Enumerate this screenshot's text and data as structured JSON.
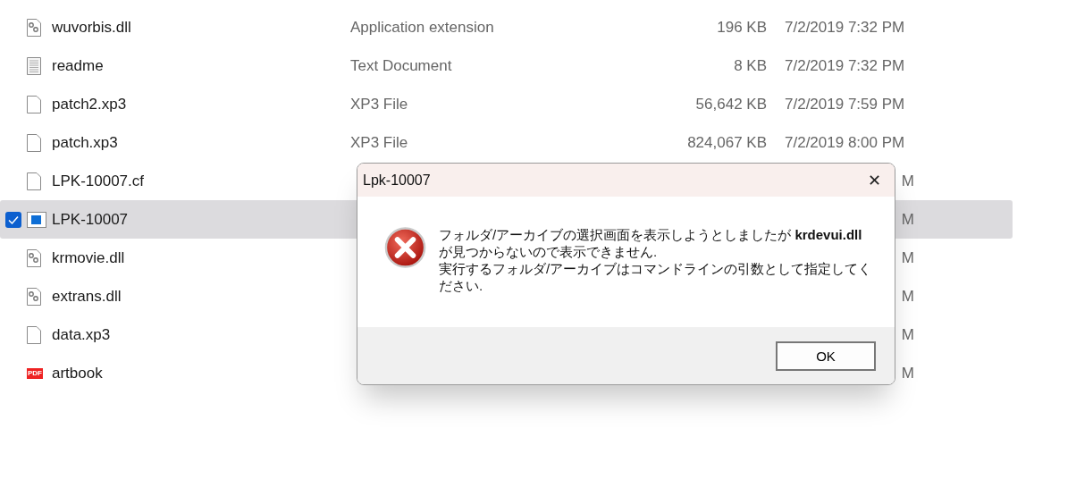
{
  "files": [
    {
      "name": "wuvorbis.dll",
      "kind": "dll",
      "type": "Application extension",
      "size": "196 KB",
      "date": "7/2/2019 7:32 PM",
      "selected": false
    },
    {
      "name": "readme",
      "kind": "text",
      "type": "Text Document",
      "size": "8 KB",
      "date": "7/2/2019 7:32 PM",
      "selected": false
    },
    {
      "name": "patch2.xp3",
      "kind": "blank",
      "type": "XP3 File",
      "size": "56,642 KB",
      "date": "7/2/2019 7:59 PM",
      "selected": false
    },
    {
      "name": "patch.xp3",
      "kind": "blank",
      "type": "XP3 File",
      "size": "824,067 KB",
      "date": "7/2/2019 8:00 PM",
      "selected": false
    },
    {
      "name": "LPK-10007.cf",
      "kind": "blank",
      "date": "M",
      "selected": false
    },
    {
      "name": "LPK-10007",
      "kind": "app",
      "date": "M",
      "selected": true
    },
    {
      "name": "krmovie.dll",
      "kind": "dll",
      "date": "M",
      "selected": false
    },
    {
      "name": "extrans.dll",
      "kind": "dll",
      "date": "M",
      "selected": false
    },
    {
      "name": "data.xp3",
      "kind": "blank",
      "date": "M",
      "selected": false
    },
    {
      "name": "artbook",
      "kind": "pdf",
      "icon_label": "PDF",
      "date": "M",
      "selected": false
    }
  ],
  "dialog": {
    "title": "Lpk-10007",
    "close": "✕",
    "message": [
      "フォルダ/アーカイブの選択画面を表示しようとしましたが **krdevui.dll** が見つからないので表示できません.",
      "実行するフォルダ/アーカイブはコマンドラインの引数として指定してください."
    ],
    "buttons": [
      "OK"
    ]
  }
}
